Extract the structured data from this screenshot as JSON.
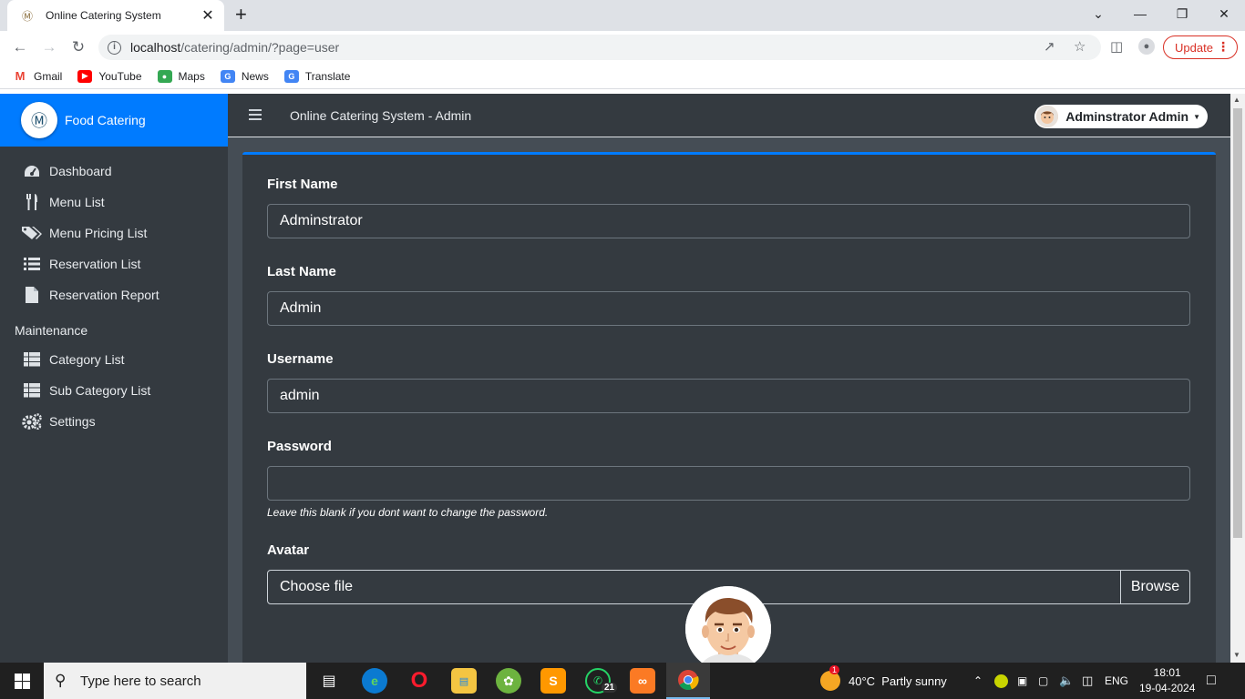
{
  "browser": {
    "tab_title": "Online Catering System",
    "url_host": "localhost",
    "url_path": "/catering/admin/?page=user",
    "update_label": "Update",
    "bookmarks": [
      "Gmail",
      "YouTube",
      "Maps",
      "News",
      "Translate"
    ]
  },
  "sidebar": {
    "brand": "Food Catering",
    "items": [
      {
        "label": "Dashboard",
        "icon": "tachometer-icon"
      },
      {
        "label": "Menu List",
        "icon": "utensils-icon"
      },
      {
        "label": "Menu Pricing List",
        "icon": "tags-icon"
      },
      {
        "label": "Reservation List",
        "icon": "list-icon"
      },
      {
        "label": "Reservation Report",
        "icon": "file-icon"
      }
    ],
    "maintenance_header": "Maintenance",
    "maintenance_items": [
      {
        "label": "Category List",
        "icon": "th-list-icon"
      },
      {
        "label": "Sub Category List",
        "icon": "th-list-icon"
      },
      {
        "label": "Settings",
        "icon": "cogs-icon"
      }
    ]
  },
  "topnav": {
    "title": "Online Catering System - Admin",
    "user": "Adminstrator Admin"
  },
  "form": {
    "first_name_label": "First Name",
    "first_name_value": "Adminstrator",
    "last_name_label": "Last Name",
    "last_name_value": "Admin",
    "username_label": "Username",
    "username_value": "admin",
    "password_label": "Password",
    "password_value": "",
    "password_hint": "Leave this blank if you dont want to change the password.",
    "avatar_label": "Avatar",
    "file_placeholder": "Choose file",
    "browse_label": "Browse"
  },
  "taskbar": {
    "search_placeholder": "Type here to search",
    "weather": "40°C  Partly sunny",
    "language": "ENG",
    "time": "18:01",
    "date": "19-04-2024",
    "whatsapp_badge": "21",
    "weather_badge": "1"
  }
}
